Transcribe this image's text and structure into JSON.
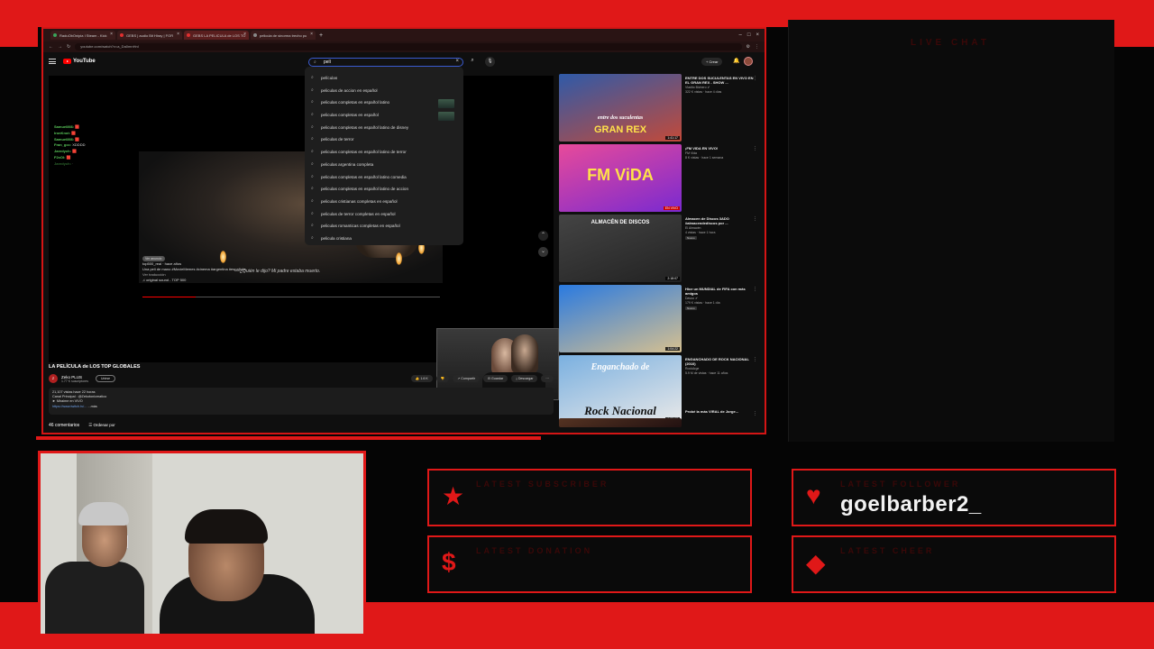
{
  "browser": {
    "tabs": [
      {
        "label": "RaduObOnipia I Steam - Kick"
      },
      {
        "label": "GEBS | audio Bit Hiray | FOR"
      },
      {
        "label": "GEBS LA PELICULA de LOS TO"
      },
      {
        "label": "pelicula de sinorma trecho pu"
      }
    ],
    "url": "youtube.com/watch?v=a_Da0mnHnI"
  },
  "youtube": {
    "logo_text": "YouTube",
    "search_value": "pelí",
    "create_label": "+ Crear",
    "suggestions": [
      "películas",
      "peliculas de accion en español",
      "peliculas completas en español latino",
      "peliculas completas en español",
      "peliculas completas en español latino de disney",
      "peliculas de terror",
      "peliculas completas en español latino de terror",
      "peliculas argentina completa",
      "peliculas completas en español latino comedia",
      "peliculas completas en español latino de accion",
      "peliculas cristianas completas en español",
      "peliculas de terror completas en español",
      "peliculas romanticas completas en español",
      "pelicula cristiana"
    ],
    "chat_overlay": [
      {
        "user": "Samuel866:",
        "msg": "🟥"
      },
      {
        "user": "IronKnot:",
        "msg": "🟥"
      },
      {
        "user": "Samuel866:",
        "msg": "🟥"
      },
      {
        "user": "Fran_gcc:",
        "msg": "XDDDD"
      },
      {
        "user": "Jaredych:",
        "msg": "🟥"
      },
      {
        "user": "F2xOl:",
        "msg": "🟥"
      },
      {
        "user": "Jaredych:",
        "msg": "·"
      }
    ],
    "video_meta": {
      "tag": "Ver anuncio",
      "user": "top500_real · hace años",
      "line1": "Una peli de mano #MovieMemes #cinema #argentina #española",
      "line2": "Ver traducción",
      "sound": "♫ original sound - TOP 500",
      "caption": "—¿Quién le dijo? Mi padre estaba muerto."
    },
    "title": "LA PELÍCULA de LOS TOP GLOBALES",
    "channel": {
      "name": "Zeko PLUS",
      "subs": "1.77 K suscriptores",
      "join": "Unirse",
      "avatar": "Z"
    },
    "actions": [
      "👍 1.6 K",
      "👎",
      "↗ Compartir",
      "⊟ Guardar",
      "⤓ Descargar",
      "⋯"
    ],
    "description": {
      "line1": "21,107 vistas  hace 22 horas",
      "line2": "Canal Principal : @Zekotonicmatico",
      "line3": "► Miraime en VIVO",
      "link": "https://www.twitch.tv/...",
      "more": "...más"
    },
    "comments_count": "46 comentarios",
    "sort_label": "☰ Ordenar por",
    "recommendations": [
      {
        "title": "ENTRE DOS SUCULENTAS EN VIVO EN EL GRAN REX - SHOW ...",
        "channel": "Vladito Bichero ✔",
        "meta": "322 K vistas · hace 4 días",
        "duration": "1:41:17",
        "thumb_text": "GRAN REX",
        "thumb_sub": "entre dos suculentas",
        "thumb_colors": [
          "#2f5aa8",
          "#c24a3a"
        ]
      },
      {
        "title": "¡FM VIDA EN VIVO!",
        "channel": "FM Vida",
        "meta": "8 K vistas · hace 1 semana",
        "duration": "EN VIVO",
        "thumb_text": "FM ViDA",
        "thumb_sub": "",
        "thumb_colors": [
          "#e84a9a",
          "#7a2ad0"
        ]
      },
      {
        "title": "Almacen de Discos 3ADO #almacendediscos por ...",
        "channel": "El Almacén",
        "meta": "4 vistas · hace 1 hora",
        "duration": "2:18:07",
        "thumb_text": "ALMACÉN DE DISCOS",
        "thumb_sub": "",
        "thumb_colors": [
          "#444",
          "#222"
        ],
        "badge": "Nuevo"
      },
      {
        "title": "Hice un MUNDIAL de FIFA con más amigos",
        "channel": "Davoo ✔",
        "meta": "179 K vistas · hace 1 día",
        "duration": "1:04:22",
        "thumb_text": "",
        "thumb_sub": "",
        "thumb_colors": [
          "#2a7ae0",
          "#d6c090"
        ],
        "badge": "Nuevo"
      },
      {
        "title": "ENGANCHADO DE ROCK NACIONAL (2010)",
        "channel": "RockArge",
        "meta": "5.9 M de vistas · hace 11 años",
        "duration": "1:28:07",
        "thumb_text": "Rock Nacional",
        "thumb_sub": "Enganchado de",
        "thumb_colors": [
          "#7ab0e0",
          "#e8e8e8"
        ]
      },
      {
        "title": "Probé la más VIRAL de Jorge...",
        "channel": "",
        "meta": "",
        "duration": "",
        "thumb_text": "",
        "thumb_sub": "",
        "thumb_colors": [
          "#553322",
          "#221111"
        ]
      }
    ]
  },
  "overlay": {
    "live_chat_label": "LIVE CHAT",
    "latest_subscriber": {
      "label": "LATEST SUBSCRIBER",
      "value": ""
    },
    "latest_follower": {
      "label": "LATEST FOLLOWER",
      "value": "goelbarber2_"
    },
    "latest_donation": {
      "label": "LATEST DONATION",
      "value": ""
    },
    "latest_cheer": {
      "label": "LATEST CHEER",
      "value": ""
    }
  },
  "colors": {
    "accent": "#e01818",
    "background": "#050505"
  },
  "icons": {
    "subscriber": "star-icon",
    "follower": "heart-icon",
    "donation": "dollar-icon",
    "cheer": "diamond-icon"
  }
}
